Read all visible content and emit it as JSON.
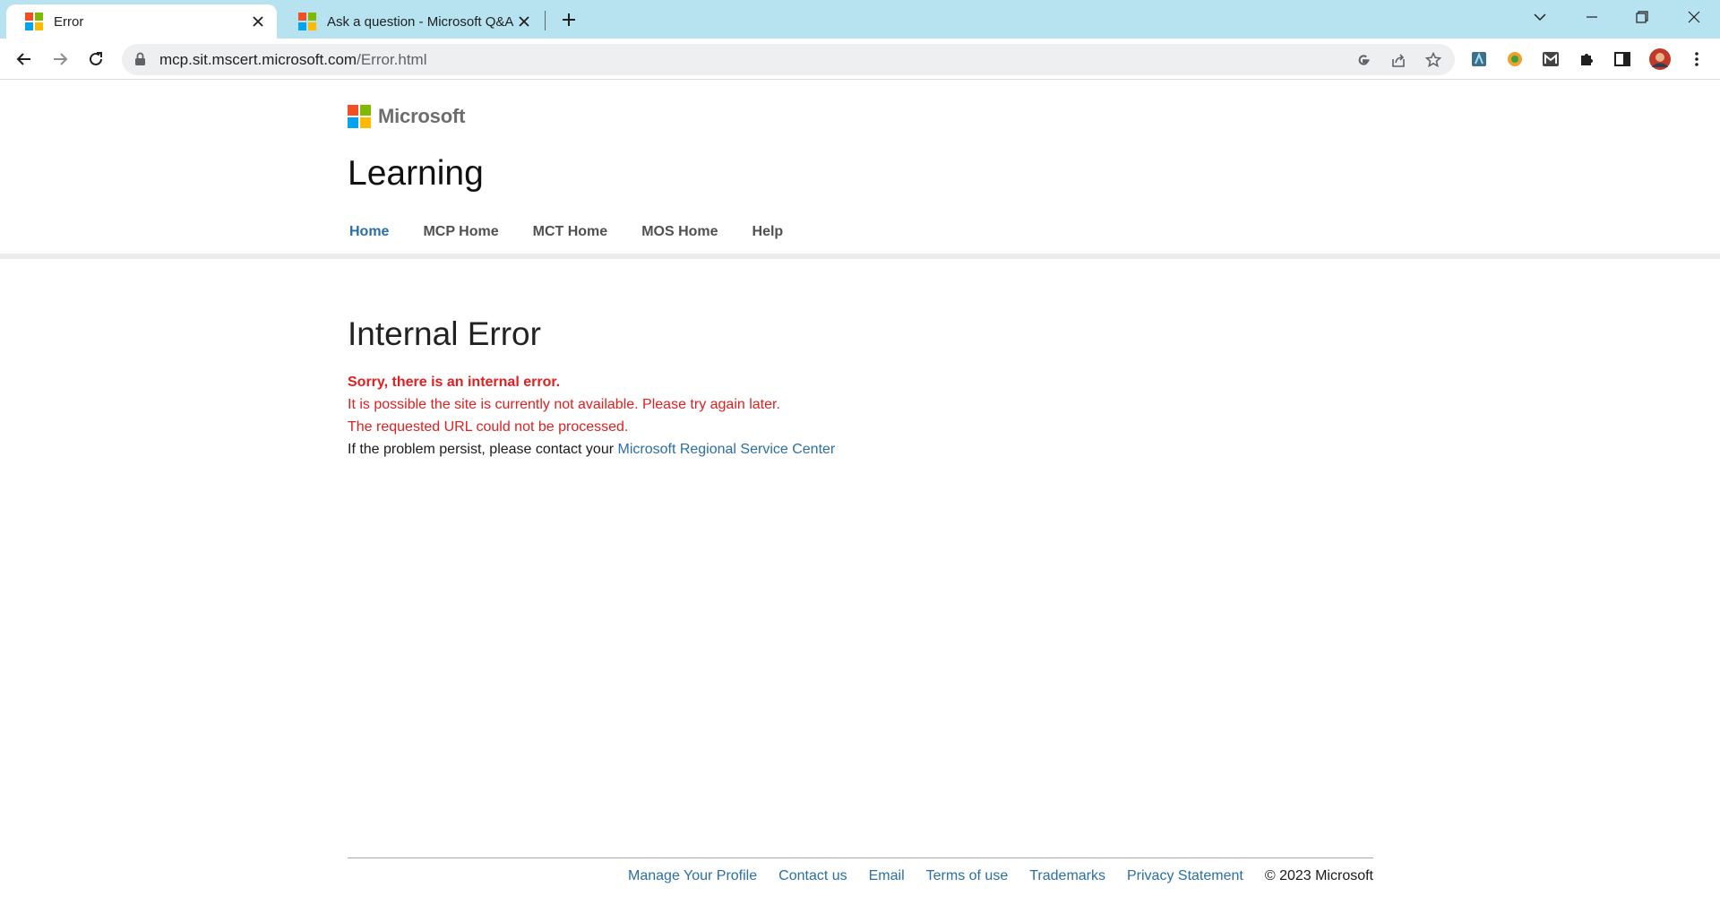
{
  "browser": {
    "tabs": [
      {
        "title": "Error",
        "icon": "microsoft-logo-icon",
        "active": true
      },
      {
        "title": "Ask a question - Microsoft Q&A",
        "icon": "microsoft-logo-icon",
        "active": false
      }
    ],
    "address": {
      "host": "mcp.sit.mscert.microsoft.com",
      "path": "/Error.html"
    }
  },
  "site": {
    "brand": "Microsoft",
    "title": "Learning",
    "nav": [
      "Home",
      "MCP Home",
      "MCT Home",
      "MOS Home",
      "Help"
    ]
  },
  "error": {
    "title": "Internal Error",
    "line1": "Sorry, there is an internal error.",
    "line2": "It is possible the site is currently not available. Please try again later.",
    "line3": "The requested URL could not be processed.",
    "line4_prefix": "If the problem persist, please contact your ",
    "line4_link": "Microsoft Regional Service Center"
  },
  "footer": {
    "links": [
      "Manage Your Profile",
      "Contact us",
      "Email",
      "Terms of use",
      "Trademarks",
      "Privacy Statement"
    ],
    "copyright": "© 2023 Microsoft"
  },
  "colors": {
    "ms_red": "#f25022",
    "ms_green": "#7fba00",
    "ms_blue": "#00a4ef",
    "ms_yellow": "#ffb900",
    "error_red": "#e02020",
    "link_blue": "#2a6fa6",
    "tabstrip": "#b7e2ef"
  }
}
